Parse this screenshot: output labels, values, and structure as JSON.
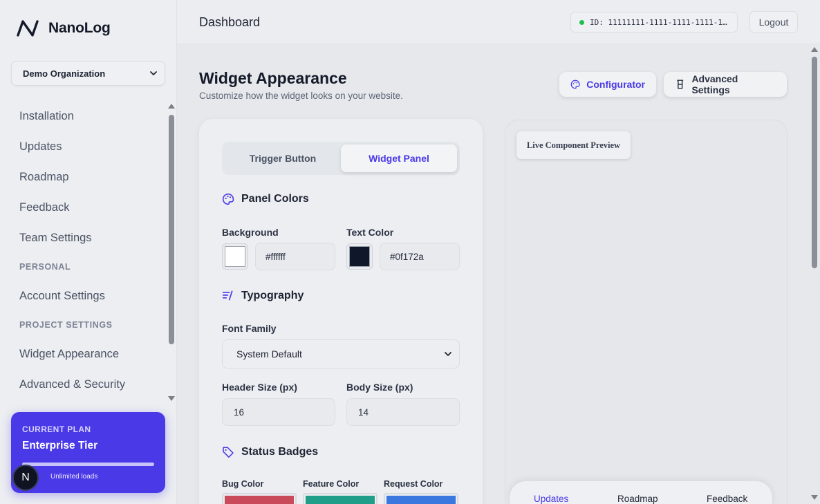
{
  "brand": {
    "name": "NanoLog",
    "icon": "nanolog-logo-icon"
  },
  "org": {
    "selected": "Demo Organization"
  },
  "sidebar": {
    "items": [
      {
        "type": "item",
        "label": "Installation"
      },
      {
        "type": "item",
        "label": "Updates"
      },
      {
        "type": "item",
        "label": "Roadmap"
      },
      {
        "type": "item",
        "label": "Feedback"
      },
      {
        "type": "item",
        "label": "Team Settings"
      },
      {
        "type": "section",
        "label": "PERSONAL"
      },
      {
        "type": "item",
        "label": "Account Settings"
      },
      {
        "type": "section",
        "label": "PROJECT SETTINGS"
      },
      {
        "type": "item",
        "label": "Widget Appearance"
      },
      {
        "type": "item",
        "label": "Advanced & Security"
      }
    ]
  },
  "plan": {
    "label": "CURRENT PLAN",
    "name": "Enterprise Tier",
    "usage_fraction": 1.0,
    "subtext": "Unlimited loads",
    "avatar_letter": "N"
  },
  "header": {
    "title": "Dashboard",
    "id_text": "ID: 11111111-1111-1111-1111-1…",
    "status_color": "#1fbf4f",
    "logout_label": "Logout"
  },
  "page": {
    "title": "Widget Appearance",
    "subtitle": "Customize how the widget looks on your website.",
    "configurator_label": "Configurator",
    "advanced_label": "Advanced Settings"
  },
  "tabs": [
    {
      "label": "Trigger Button",
      "active": false
    },
    {
      "label": "Widget Panel",
      "active": true
    }
  ],
  "panel_colors": {
    "title": "Panel Colors",
    "background_label": "Background",
    "background_value": "#ffffff",
    "text_label": "Text Color",
    "text_value": "#0f172a"
  },
  "typography": {
    "title": "Typography",
    "font_family_label": "Font Family",
    "font_family_value": "System Default",
    "header_size_label": "Header Size (px)",
    "header_size_value": "16",
    "body_size_label": "Body Size (px)",
    "body_size_value": "14"
  },
  "status_badges": {
    "title": "Status Badges",
    "bug_label": "Bug Color",
    "bug_color": "#c94a5a",
    "feature_label": "Feature Color",
    "feature_color": "#1f9e8a",
    "request_label": "Request Color",
    "request_color": "#3a78e0"
  },
  "preview": {
    "label": "Live Component Preview",
    "nav": [
      "Updates",
      "Roadmap",
      "Feedback"
    ]
  },
  "colors": {
    "accent": "#4a39e6"
  }
}
